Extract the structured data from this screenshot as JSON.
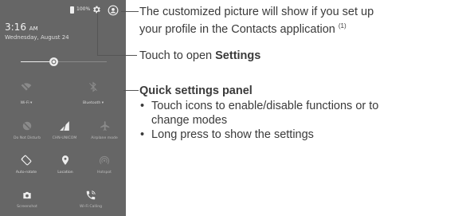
{
  "phone": {
    "battery_text": "100%",
    "time": "3:16",
    "time_suffix": "AM",
    "date": "Wednesday, August 24",
    "brightness_level": 0.35,
    "tiles": [
      {
        "label": "Wi-Fi ▾",
        "icon": "wifi-icon"
      },
      {
        "label": "Bluetooth ▾",
        "icon": "bluetooth-icon"
      },
      {
        "label": "Do Not Disturb",
        "icon": "do-not-disturb-icon"
      },
      {
        "label": "CHN-UNICOM",
        "icon": "signal-icon"
      },
      {
        "label": "Airplane mode",
        "icon": "airplane-icon"
      },
      {
        "label": "Auto-rotate",
        "icon": "auto-rotate-icon"
      },
      {
        "label": "Location",
        "icon": "location-icon"
      },
      {
        "label": "Hotspot",
        "icon": "hotspot-icon"
      },
      {
        "label": "Screenshot",
        "icon": "screenshot-icon"
      },
      {
        "label": "Wi-Fi Calling",
        "icon": "wifi-calling-icon"
      }
    ]
  },
  "annotations": {
    "profile_line1": "The customized picture will show if you set up",
    "profile_line2": "your profile in the Contacts application",
    "profile_sup": "(1)",
    "settings_prefix": "Touch to open ",
    "settings_bold": "Settings",
    "qs_title": "Quick settings panel",
    "bullet1_line1": "Touch icons to enable/disable functions or to",
    "bullet1_line2": "change modes",
    "bullet2": "Long press to show the settings"
  }
}
